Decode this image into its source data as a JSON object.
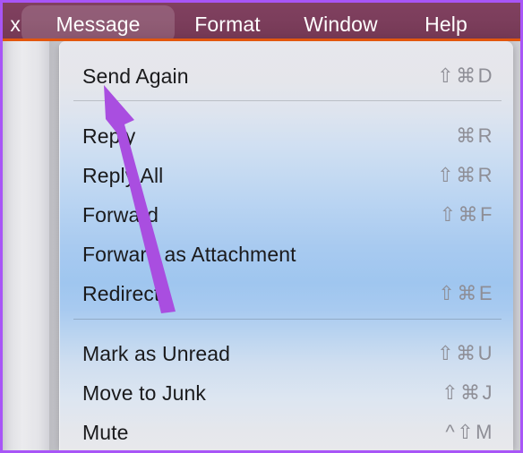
{
  "menu_bar": {
    "background_color": "#7b3d5b",
    "accent_color": "#e2560e",
    "items": [
      {
        "label": "x",
        "name": "menubar-item-mailbox-truncated",
        "active": false
      },
      {
        "label": "Message",
        "name": "menubar-item-message",
        "active": true
      },
      {
        "label": "Format",
        "name": "menubar-item-format",
        "active": false
      },
      {
        "label": "Window",
        "name": "menubar-item-window",
        "active": false
      },
      {
        "label": "Help",
        "name": "menubar-item-help",
        "active": false
      }
    ]
  },
  "message_menu": {
    "groups": [
      {
        "items": [
          {
            "label": "Send Again",
            "shortcut": "⇧⌘D"
          }
        ]
      },
      {
        "items": [
          {
            "label": "Reply",
            "shortcut": "⌘R"
          },
          {
            "label": "Reply All",
            "shortcut": "⇧⌘R"
          },
          {
            "label": "Forward",
            "shortcut": "⇧⌘F"
          },
          {
            "label": "Forward as Attachment",
            "shortcut": ""
          },
          {
            "label": "Redirect",
            "shortcut": "⇧⌘E"
          }
        ]
      },
      {
        "items": [
          {
            "label": "Mark as Unread",
            "shortcut": "⇧⌘U"
          },
          {
            "label": "Move to Junk",
            "shortcut": "⇧⌘J"
          },
          {
            "label": "Mute",
            "shortcut": "^⇧M"
          }
        ]
      }
    ]
  },
  "annotation": {
    "arrow_color": "#a94ee0",
    "points_at": "Send Again"
  },
  "frame": {
    "border_color": "#a855f7"
  }
}
